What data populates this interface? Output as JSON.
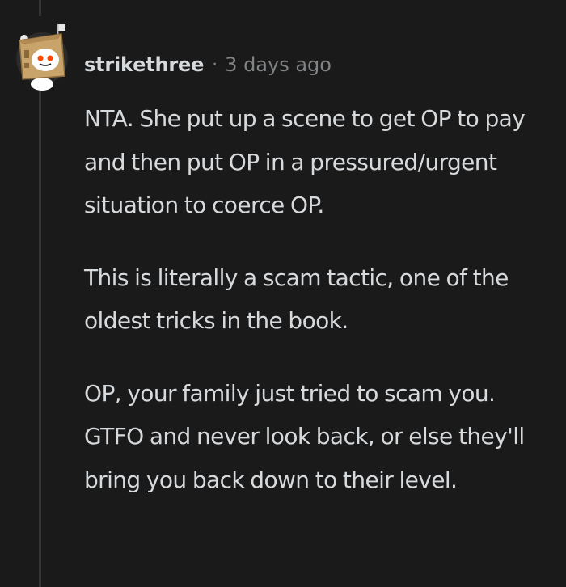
{
  "comment": {
    "author": "strikethree",
    "separator": "·",
    "timestamp": "3 days ago",
    "avatar_icon": "snoo-box-avatar-icon",
    "paragraphs": [
      "NTA. She put up a scene to get OP to pay and then put OP in a pressured/urgent situation to coerce OP.",
      "This is literally a scam tactic, one of the oldest tricks in the book.",
      "OP, your family just tried to scam you. GTFO and never look back, or else they'll bring you back down to their level."
    ]
  },
  "colors": {
    "background": "#1a1a1b",
    "text": "#d7dadc",
    "muted": "#818384",
    "thread_line": "#343536"
  }
}
